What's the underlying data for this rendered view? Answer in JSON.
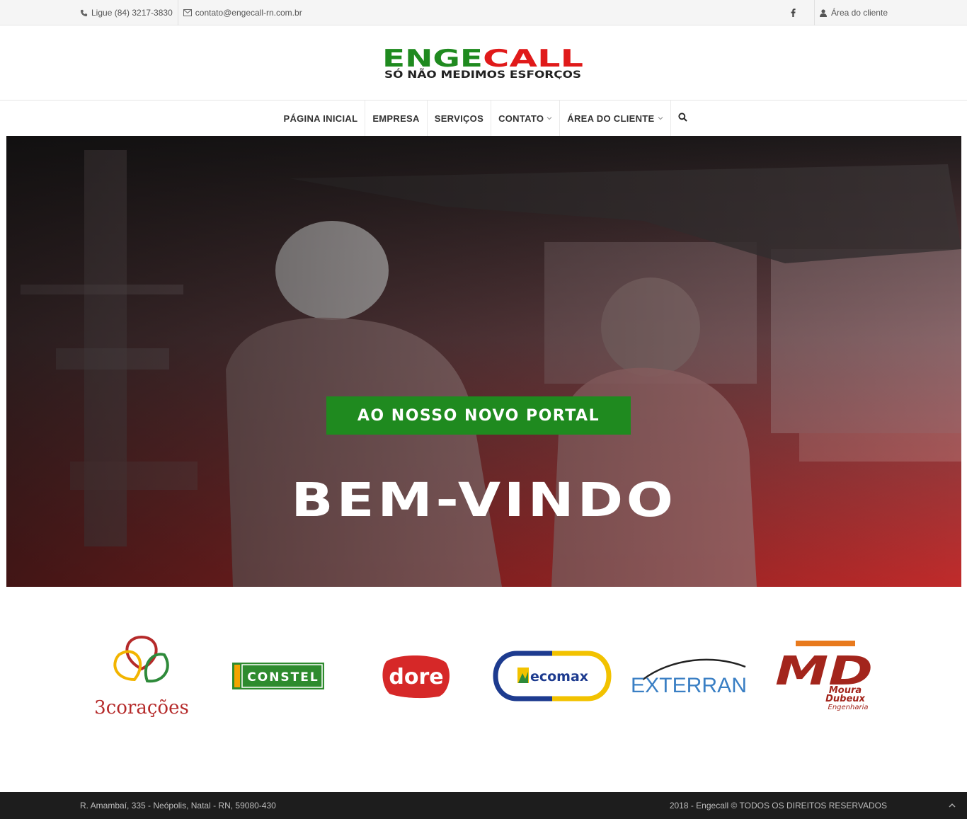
{
  "topbar": {
    "phone": "Ligue (84) 3217-3830",
    "email": "contato@engecall-rn.com.br",
    "facebook_icon": "facebook-icon",
    "client_area": "Área do cliente"
  },
  "logo": {
    "brand_left": "ENGE",
    "brand_right": "CALL",
    "tagline": "SÓ NÃO MEDIMOS ESFORÇOS",
    "colors": {
      "green": "#1f8a1f",
      "red": "#e01a1a",
      "dark": "#222222"
    }
  },
  "nav": {
    "items": [
      {
        "label": "PÁGINA INICIAL"
      },
      {
        "label": "EMPRESA"
      },
      {
        "label": "SERVIÇOS"
      },
      {
        "label": "CONTATO"
      },
      {
        "label": "ÁREA DO CLIENTE"
      }
    ],
    "search_icon": "search-icon"
  },
  "hero": {
    "title": "BEM-VINDO",
    "subtitle": "AO NOSSO NOVO PORTAL",
    "overlay_color": "#b52a2a"
  },
  "partners": [
    {
      "name": "3corações"
    },
    {
      "name": "CONSTEL"
    },
    {
      "name": "dore"
    },
    {
      "name": "ecomax"
    },
    {
      "name": "EXTERRAN"
    },
    {
      "name": "MD",
      "line1": "Moura",
      "line2": "Dubeux",
      "line3": "Engenharia"
    }
  ],
  "footer": {
    "address": "R. Amambaí, 335 - Neópolis, Natal - RN, 59080-430",
    "copyright": "2018 - Engecall © TODOS OS DIREITOS RESERVADOS"
  }
}
